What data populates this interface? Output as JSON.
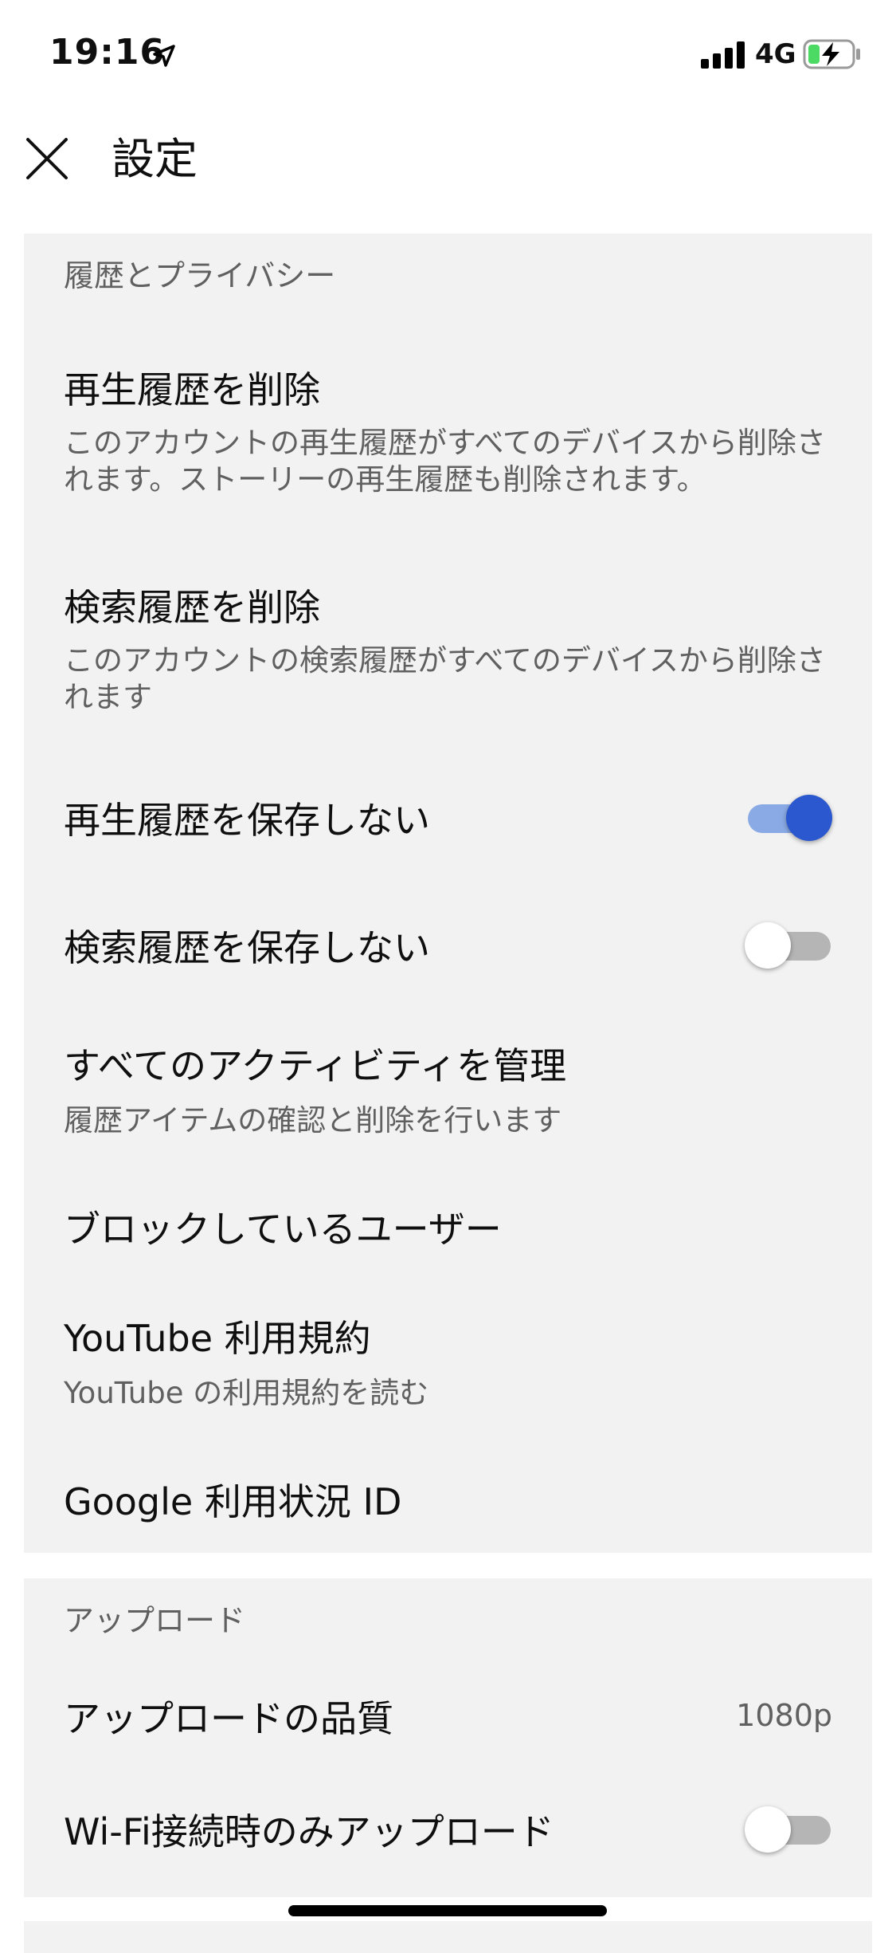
{
  "status_bar": {
    "time": "19:16",
    "network": "4G"
  },
  "header": {
    "title": "設定"
  },
  "privacy": {
    "header": "履歴とプライバシー",
    "items": [
      {
        "title": "再生履歴を削除",
        "subtitle": "このアカウントの再生履歴がすべてのデバイスから削除されます。ストーリーの再生履歴も削除されます。"
      },
      {
        "title": "検索履歴を削除",
        "subtitle": "このアカウントの検索履歴がすべてのデバイスから削除されます"
      },
      {
        "title": "再生履歴を保存しない",
        "toggle_on": true
      },
      {
        "title": "検索履歴を保存しない",
        "toggle_on": false
      },
      {
        "title": "すべてのアクティビティを管理",
        "subtitle": "履歴アイテムの確認と削除を行います"
      },
      {
        "title": "ブロックしているユーザー"
      },
      {
        "title": "YouTube 利用規約",
        "subtitle": "YouTube の利用規約を読む"
      },
      {
        "title": "Google 利用状況 ID"
      }
    ]
  },
  "upload": {
    "header": "アップロード",
    "items": [
      {
        "title": "アップロードの品質",
        "value": "1080p"
      },
      {
        "title": "Wi-Fi接続時のみアップロード",
        "toggle_on": false
      }
    ]
  },
  "colors": {
    "accent": "#2b58cf",
    "section_bg": "#f2f2f2"
  }
}
